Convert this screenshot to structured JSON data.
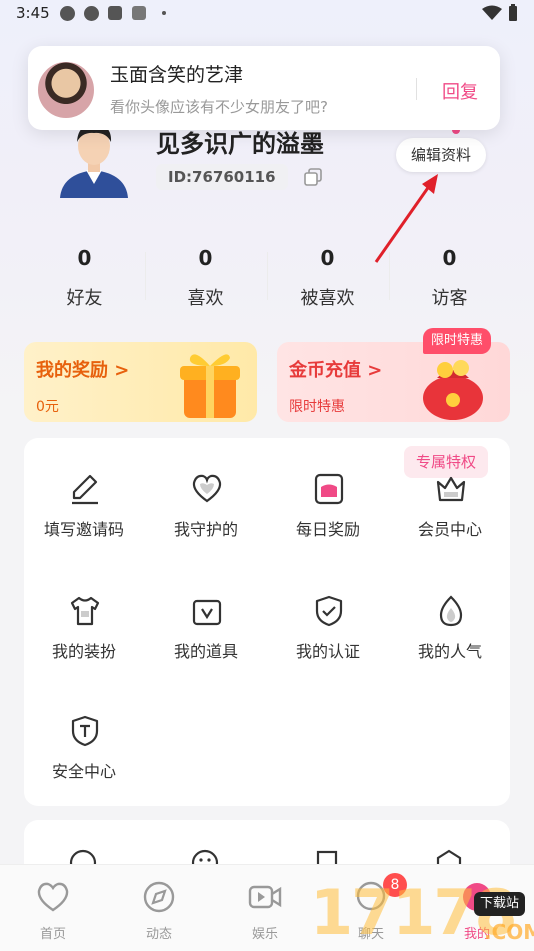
{
  "status_bar": {
    "time": "3:45"
  },
  "notification": {
    "sender": "玉面含笑的艺津",
    "message": "看你头像应该有不少女朋友了吧?",
    "reply_label": "回复"
  },
  "profile": {
    "username": "见多识广的溢墨",
    "id_text": "ID:76760116",
    "edit_label": "编辑资料"
  },
  "stats": [
    {
      "value": "0",
      "label": "好友"
    },
    {
      "value": "0",
      "label": "喜欢"
    },
    {
      "value": "0",
      "label": "被喜欢"
    },
    {
      "value": "0",
      "label": "访客"
    }
  ],
  "promo": {
    "reward": {
      "title": "我的奖励 >",
      "sub": "0元"
    },
    "coin": {
      "title": "金币充值 >",
      "sub": "限时特惠",
      "badge": "限时特惠"
    }
  },
  "menu": {
    "exclusive_label": "专属特权",
    "items": [
      {
        "label": "填写邀请码",
        "icon": "pen-icon"
      },
      {
        "label": "我守护的",
        "icon": "heart-icon"
      },
      {
        "label": "每日奖励",
        "icon": "wallet-icon"
      },
      {
        "label": "会员中心",
        "icon": "crown-icon"
      },
      {
        "label": "我的装扮",
        "icon": "shirt-icon"
      },
      {
        "label": "我的道具",
        "icon": "box-icon"
      },
      {
        "label": "我的认证",
        "icon": "shield-check-icon"
      },
      {
        "label": "我的人气",
        "icon": "flame-icon"
      },
      {
        "label": "安全中心",
        "icon": "shield-t-icon"
      }
    ]
  },
  "tabbar": {
    "tabs": [
      {
        "label": "首页",
        "icon": "heart-outline-icon"
      },
      {
        "label": "动态",
        "icon": "compass-icon"
      },
      {
        "label": "娱乐",
        "icon": "video-icon"
      },
      {
        "label": "聊天",
        "icon": "chat-icon"
      },
      {
        "label": "我的",
        "icon": "profile-icon"
      }
    ],
    "chat_badge": "8"
  },
  "watermark": {
    "digits": "17178",
    "tag": "下载站",
    "domain": ".COM"
  },
  "colors": {
    "accent": "#f04a86",
    "reward_text": "#e7610d",
    "coin_text": "#e73b3b"
  }
}
